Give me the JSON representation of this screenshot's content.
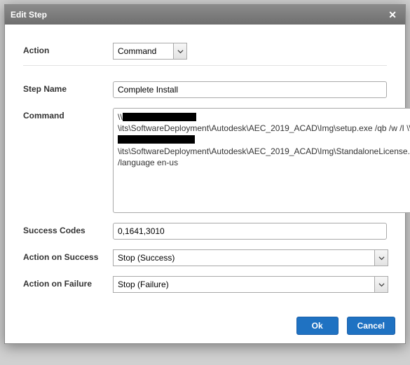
{
  "dialog": {
    "title": "Edit Step"
  },
  "labels": {
    "action": "Action",
    "stepName": "Step Name",
    "command": "Command",
    "successCodes": "Success Codes",
    "actionOnSuccess": "Action on Success",
    "actionOnFailure": "Action on Failure"
  },
  "fields": {
    "action": {
      "selected": "Command"
    },
    "stepName": {
      "value": "Complete Install"
    },
    "command": {
      "prefix": "\\\\",
      "seg1": "\\its\\SoftwareDeployment\\Autodesk\\AEC_2019_ACAD\\Img\\setup.exe /qb /w /I \\\\",
      "seg2": "\\its\\SoftwareDeployment\\Autodesk\\AEC_2019_ACAD\\Img\\StandaloneLicense.ini /language en-us"
    },
    "successCodes": {
      "value": "0,1641,3010"
    },
    "actionOnSuccess": {
      "selected": "Stop (Success)"
    },
    "actionOnFailure": {
      "selected": "Stop (Failure)"
    }
  },
  "buttons": {
    "ok": "Ok",
    "cancel": "Cancel"
  }
}
